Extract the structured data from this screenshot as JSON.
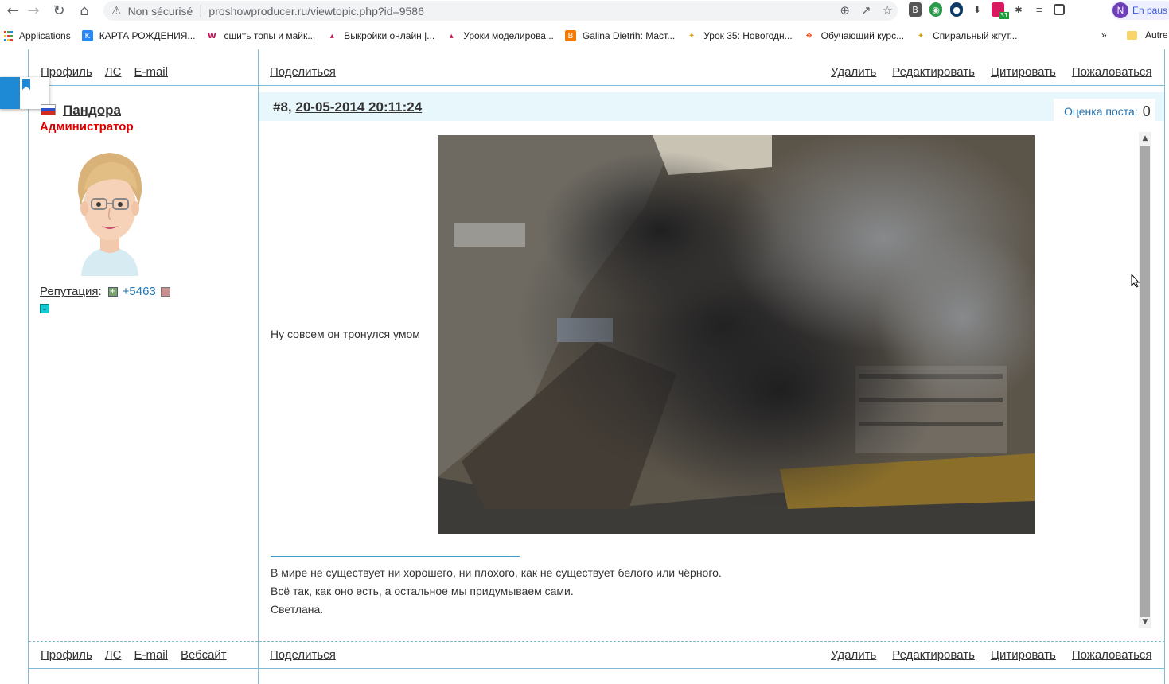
{
  "browser": {
    "security_label": "Non sécurisé",
    "url": "proshowproducer.ru/viewtopic.php?id=9586",
    "profile_initial": "N",
    "profile_label": "En paus",
    "extension_badge": "31",
    "extension_letter": "B"
  },
  "bookmarks": {
    "items": [
      {
        "label": "Applications",
        "icon": "apps-grid-icon"
      },
      {
        "label": "КАРТА РОЖДЕНИЯ...",
        "icon": "vk-icon"
      },
      {
        "label": "сшить топы и майк...",
        "icon": "w-icon"
      },
      {
        "label": "Выкройки онлайн |...",
        "icon": "dress-icon"
      },
      {
        "label": "Уроки моделирова...",
        "icon": "dress-icon"
      },
      {
        "label": "Galina Dietrih: Маст...",
        "icon": "blogger-icon"
      },
      {
        "label": "Урок 35: Новогодн...",
        "icon": "sparkle-icon"
      },
      {
        "label": "Обучающий курс...",
        "icon": "figma-icon"
      },
      {
        "label": "Спиральный жгут...",
        "icon": "sparkle-icon"
      }
    ],
    "more": "»",
    "other_label": "Autre"
  },
  "top_bar": {
    "left_links": [
      "Профиль",
      "ЛС",
      "E-mail"
    ],
    "share": "Поделиться",
    "right_links": [
      "Удалить",
      "Редактировать",
      "Цитировать",
      "Пожаловаться"
    ]
  },
  "post": {
    "number": "#8",
    "date": "20-05-2014 20:11:24",
    "rating_label": "Оценка поста:",
    "rating_value": "0",
    "text": "Ну совсем он тронулся умом",
    "signature": [
      "В мире не существует ни хорошего, ни плохого, как не существует белого или чёрного.",
      "Всё так, как оно есть, а остальное мы придумываем сами.",
      "Светлана."
    ]
  },
  "author": {
    "name": "Пандора",
    "role": "Администратор",
    "reputation_label": "Репутация",
    "reputation_value": "+5463"
  },
  "bottom_bar": {
    "left_links": [
      "Профиль",
      "ЛС",
      "E-mail",
      "Вебсайт"
    ],
    "share": "Поделиться",
    "right_links": [
      "Удалить",
      "Редактировать",
      "Цитировать",
      "Пожаловаться"
    ]
  },
  "colors": {
    "border": "#7fbbd6",
    "post_header_bg": "#e8f7fc",
    "role_red": "#e00000",
    "link_blue": "#2477b3"
  }
}
